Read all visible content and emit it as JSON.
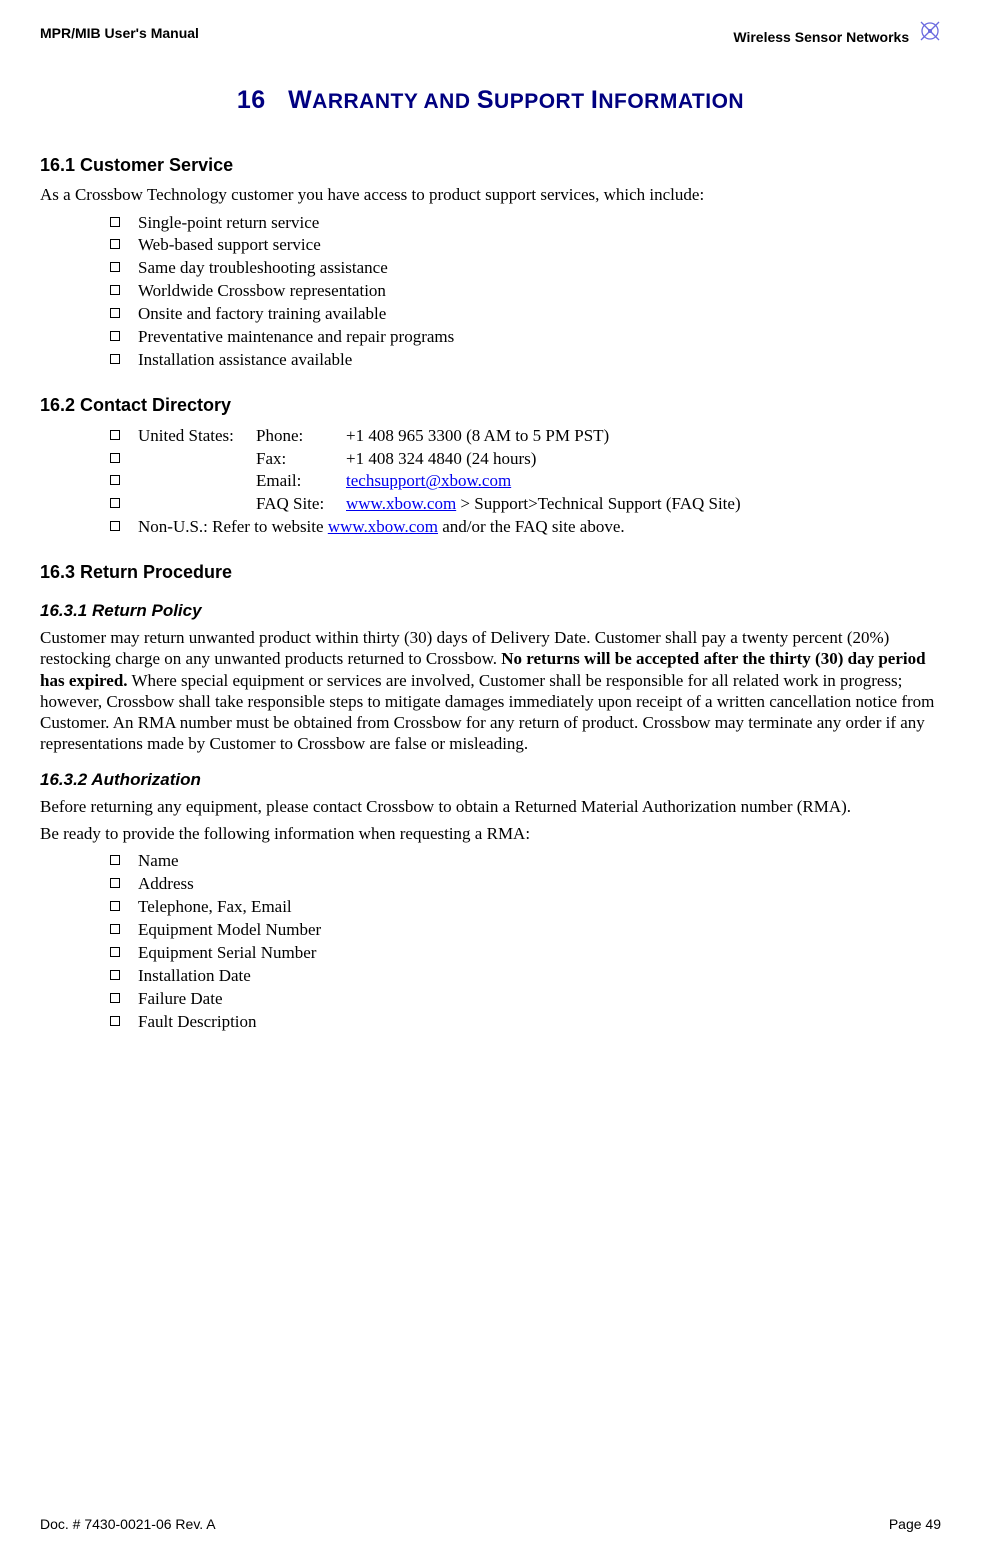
{
  "header": {
    "left": "MPR/MIB User's Manual",
    "right": "Wireless Sensor Networks"
  },
  "chapter": {
    "number": "16",
    "title_main_caps": [
      "W",
      "S",
      "I"
    ],
    "title_small": [
      "ARRANTY AND ",
      "UPPORT ",
      "NFORMATION"
    ]
  },
  "s1": {
    "heading": "16.1    Customer Service",
    "intro": "As a Crossbow Technology customer you have access to product support services, which include:",
    "items": [
      "Single-point return service",
      "Web-based support service",
      "Same day troubleshooting assistance",
      "Worldwide Crossbow representation",
      "Onsite and factory training available",
      "Preventative maintenance and repair programs",
      "Installation assistance available"
    ]
  },
  "s2": {
    "heading": "16.2    Contact Directory",
    "lines": [
      {
        "c1": "United States:",
        "c2": "Phone:",
        "c3_plain": "+1 408 965 3300 (8 AM to 5 PM PST)"
      },
      {
        "c1": "",
        "c2": "Fax:",
        "c3_plain": "+1 408 324 4840 (24 hours)"
      },
      {
        "c1": "",
        "c2": "Email:",
        "c3_link": "techsupport@xbow.com"
      },
      {
        "c1": "",
        "c2": "FAQ Site:",
        "c3_link": "www.xbow.com",
        "c3_suffix": " > Support>Technical Support (FAQ Site)"
      }
    ],
    "nonus_prefix": "Non-U.S.: Refer to website ",
    "nonus_link": "www.xbow.com",
    "nonus_suffix": " and/or the FAQ site above."
  },
  "s3": {
    "heading": "16.3    Return Procedure",
    "sub1_heading": "16.3.1      Return Policy",
    "sub1_p_pre": "Customer may return unwanted product within thirty (30) days of Delivery Date. Customer shall pay a twenty percent (20%) restocking charge on any unwanted products returned to Crossbow. ",
    "sub1_p_bold": "No returns will be accepted after the thirty (30) day period has expired.",
    "sub1_p_post": " Where special equipment or services are involved, Customer shall be responsible for all related work in progress; however, Crossbow shall take responsible steps to mitigate damages immediately upon receipt of a written cancellation notice from Customer. An RMA number must be obtained from Crossbow for any return of product. Crossbow may terminate any order if any representations made by Customer to Crossbow are false or misleading.",
    "sub2_heading": "16.3.2      Authorization",
    "sub2_p": "Before returning any equipment, please contact Crossbow to obtain a Returned Material Authorization number (RMA).",
    "sub2_lead": "Be ready to provide the following information when requesting a RMA:",
    "sub2_items": [
      "Name",
      "Address",
      "Telephone, Fax, Email",
      "Equipment Model Number",
      "Equipment Serial Number",
      "Installation Date",
      "Failure Date",
      "Fault Description"
    ]
  },
  "footer": {
    "left": "Doc. # 7430-0021-06 Rev. A",
    "right": "Page 49"
  }
}
